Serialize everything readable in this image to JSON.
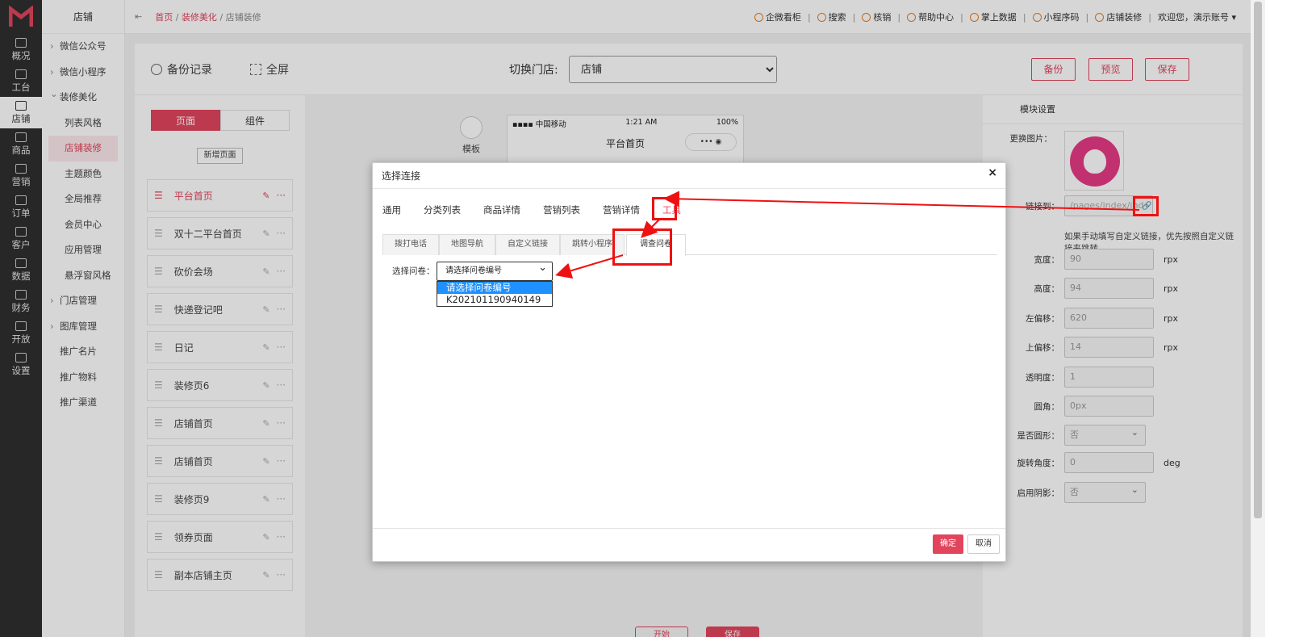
{
  "rail": [
    {
      "label": "概况",
      "icon": "overview-icon"
    },
    {
      "label": "工台",
      "icon": "desk-icon"
    },
    {
      "label": "店铺",
      "icon": "shop-icon",
      "active": true
    },
    {
      "label": "商品",
      "icon": "goods-icon"
    },
    {
      "label": "营销",
      "icon": "marketing-icon"
    },
    {
      "label": "订单",
      "icon": "order-icon"
    },
    {
      "label": "客户",
      "icon": "customer-icon"
    },
    {
      "label": "数据",
      "icon": "data-icon"
    },
    {
      "label": "财务",
      "icon": "finance-icon"
    },
    {
      "label": "开放",
      "icon": "open-icon"
    },
    {
      "label": "设置",
      "icon": "settings-icon"
    }
  ],
  "menu2": {
    "head": "店铺",
    "items": [
      "微信公众号",
      "微信小程序",
      "装修美化",
      "列表风格",
      "店铺装修",
      "主题颜色",
      "全局推荐",
      "会员中心",
      "应用管理",
      "悬浮窗风格",
      "门店管理",
      "图库管理",
      "推广名片",
      "推广物料",
      "推广渠道"
    ]
  },
  "topbar": {
    "collapse": "⇤",
    "crumb": [
      "首页",
      "装修美化",
      "店铺装修"
    ],
    "sep": "/",
    "links": [
      "企微看柜",
      "搜索",
      "核销",
      "帮助中心",
      "掌上数据",
      "小程序码",
      "店铺装修"
    ],
    "welcome": "欢迎您，演示账号 ▾"
  },
  "toolbar": {
    "backup_records": "备份记录",
    "fullscreen": "全屏",
    "switch_store_label": "切换门店:",
    "store_value": "店铺",
    "btn_backup": "备份",
    "btn_preview": "预览",
    "btn_save": "保存"
  },
  "leftpanel": {
    "seg_page": "页面",
    "seg_component": "组件",
    "add_page": "新增页面",
    "pages": [
      "平台首页",
      "双十二平台首页",
      "砍价会场",
      "快递登记吧",
      "日记",
      "装修页6",
      "店铺首页",
      "店铺首页",
      "装修页9",
      "领券页面",
      "副本店铺主页"
    ],
    "drag": "☰",
    "edit": "✎",
    "more": "···"
  },
  "canvas": {
    "template_label": "模板",
    "carrier": "▪▪▪▪ 中国移动",
    "time": "1:21 AM",
    "battery": "100%",
    "page_title": "平台首页",
    "capsule": "•••  ◉"
  },
  "rightpanel": {
    "title": "模块设置",
    "change_image": "更换图片：",
    "link_to": "链接到：",
    "link_value": "/pages/index/ind",
    "hint": "如果手动填写自定义链接，优先按照自定义链接来跳转。",
    "fields": [
      {
        "label": "宽度：",
        "value": "90",
        "unit": "rpx"
      },
      {
        "label": "高度：",
        "value": "94",
        "unit": "rpx"
      },
      {
        "label": "左偏移：",
        "value": "620",
        "unit": "rpx"
      },
      {
        "label": "上偏移：",
        "value": "14",
        "unit": "rpx"
      },
      {
        "label": "透明度：",
        "value": "1",
        "unit": ""
      },
      {
        "label": "圆角：",
        "value": "0px",
        "unit": ""
      }
    ],
    "is_circle_label": "是否圆形：",
    "is_circle_value": "否",
    "rotate_label": "旋转角度：",
    "rotate_value": "0",
    "rotate_unit": "deg",
    "shadow_label": "启用阴影：",
    "shadow_value": "否"
  },
  "bottom": {
    "btn1": "开始",
    "btn2": "保存"
  },
  "modal": {
    "title": "选择连接",
    "close": "×",
    "tabs": [
      "通用",
      "分类列表",
      "商品详情",
      "营销列表",
      "营销详情",
      "工具"
    ],
    "subtabs": [
      "拨打电话",
      "地图导航",
      "自定义链接",
      "跳转小程序",
      "调查问卷"
    ],
    "q_label": "选择问卷：",
    "q_value": "请选择问卷编号",
    "options": [
      "请选择问卷编号",
      "K202101190940149"
    ],
    "ok": "确定",
    "cancel": "取消"
  },
  "annotation_color": "#ee1111",
  "accent": "#e2445c"
}
